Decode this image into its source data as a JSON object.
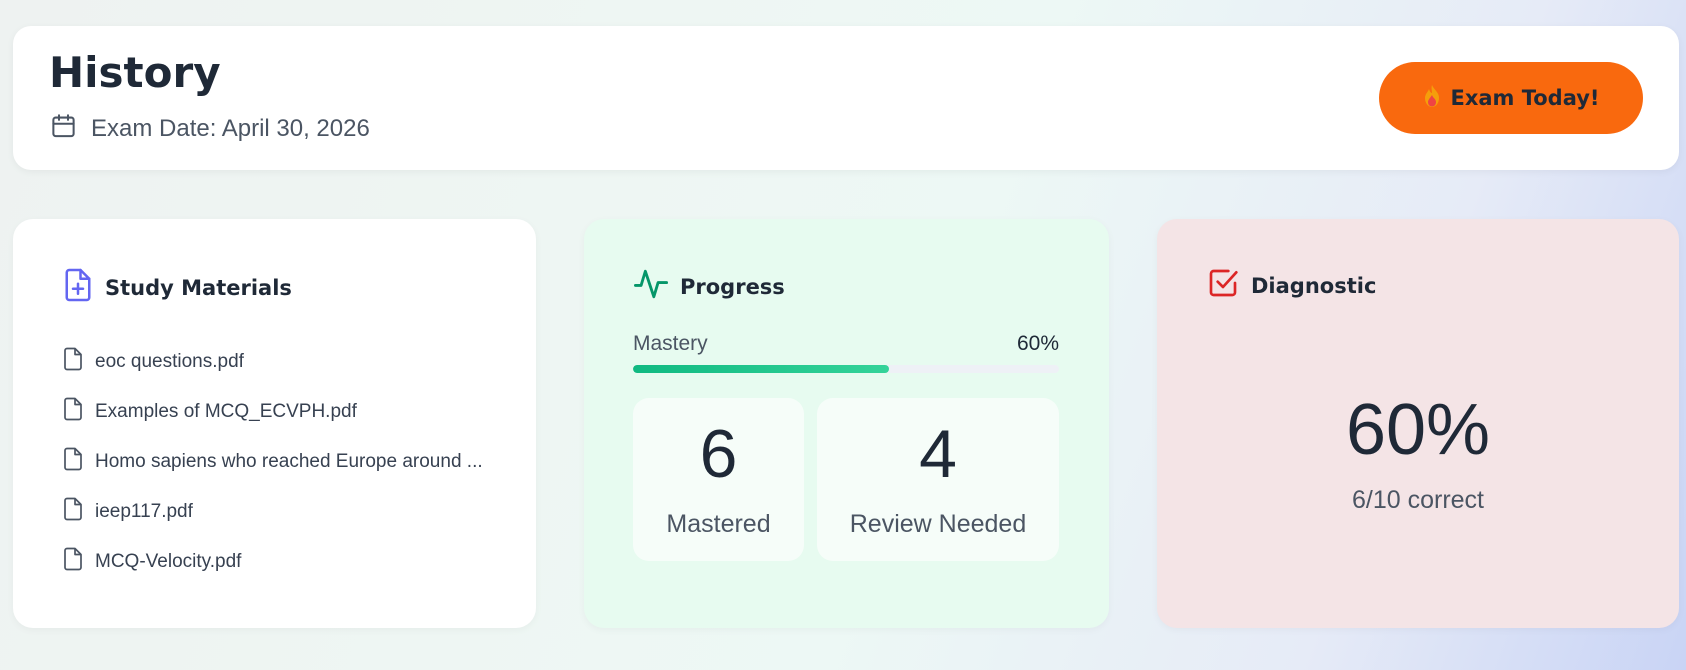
{
  "header": {
    "title": "History",
    "exam_date": "Exam Date: April 30, 2026",
    "exam_button_label": "Exam Today!",
    "exam_button_icon": "fire-icon",
    "accent_color": "#f9690e"
  },
  "materials": {
    "title": "Study Materials",
    "icon": "file-plus-icon",
    "files": [
      {
        "name": "eoc questions.pdf"
      },
      {
        "name": "Examples of MCQ_ECVPH.pdf"
      },
      {
        "name": "Homo sapiens who reached Europe around ..."
      },
      {
        "name": "ieep117.pdf"
      },
      {
        "name": "MCQ-Velocity.pdf"
      }
    ]
  },
  "progress": {
    "title": "Progress",
    "icon": "activity-icon",
    "mastery_label": "Mastery",
    "mastery_value": "60%",
    "mastery_fraction": 0.6,
    "mastered_count": "6",
    "mastered_label": "Mastered",
    "review_count": "4",
    "review_label": "Review Needed",
    "color": "#10b981"
  },
  "diagnostic": {
    "title": "Diagnostic",
    "icon": "checkbox-icon",
    "percent": "60%",
    "summary": "6/10 correct",
    "color": "#dc2626"
  }
}
